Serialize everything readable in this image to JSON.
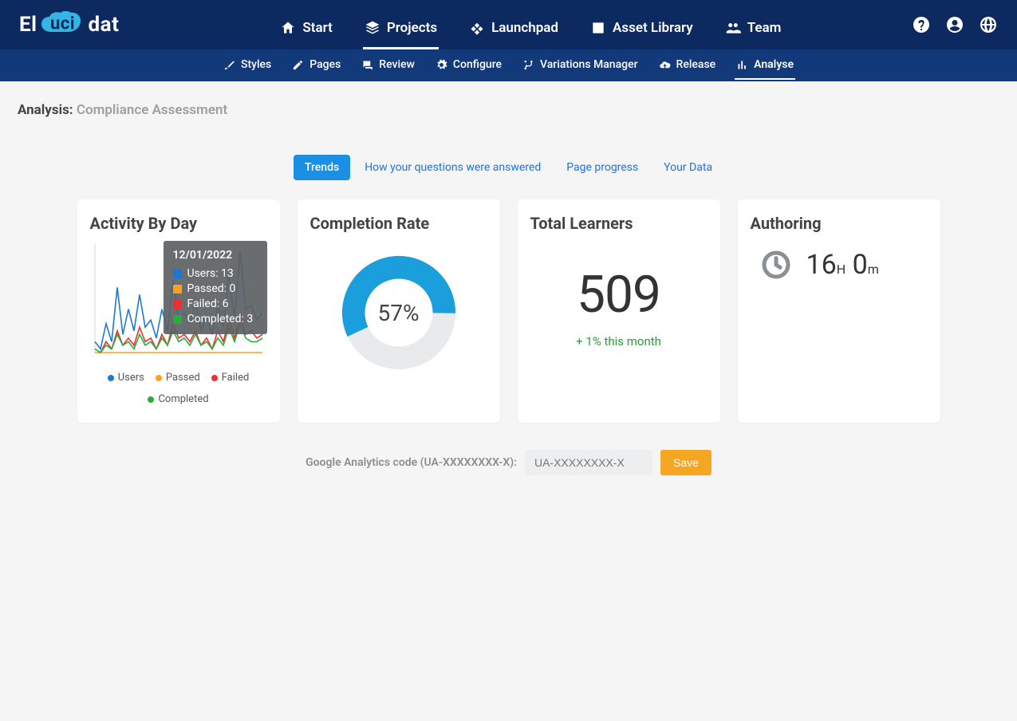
{
  "colors": {
    "blue": "#1f77d4",
    "orange": "#ff9f1a",
    "red": "#ef2f2f",
    "green": "#27ae3c",
    "grey": "#e3e6e8",
    "donut": "#1a9fdc"
  },
  "header": {
    "logo_prefix": "El",
    "logo_cloud": "uci",
    "logo_suffix": "dat",
    "nav": [
      {
        "label": "Start",
        "icon": "home"
      },
      {
        "label": "Projects",
        "icon": "layers",
        "active": true
      },
      {
        "label": "Launchpad",
        "icon": "diamond"
      },
      {
        "label": "Asset Library",
        "icon": "image"
      },
      {
        "label": "Team",
        "icon": "people"
      }
    ]
  },
  "subnav": [
    {
      "label": "Styles",
      "icon": "brush"
    },
    {
      "label": "Pages",
      "icon": "pencil"
    },
    {
      "label": "Review",
      "icon": "chat"
    },
    {
      "label": "Configure",
      "icon": "gear"
    },
    {
      "label": "Variations Manager",
      "icon": "branch"
    },
    {
      "label": "Release",
      "icon": "cloud-up"
    },
    {
      "label": "Analyse",
      "icon": "bar-chart",
      "active": true
    }
  ],
  "page": {
    "title_prefix": "Analysis:",
    "title_project": "Compliance Assessment"
  },
  "tabs": [
    {
      "label": "Trends",
      "active": true
    },
    {
      "label": "How your questions were answered"
    },
    {
      "label": "Page progress"
    },
    {
      "label": "Your Data"
    }
  ],
  "cards": {
    "activity": {
      "title": "Activity By Day",
      "tooltip": {
        "date": "12/01/2022",
        "rows": [
          {
            "label": "Users: 13",
            "color": "#1f77d4"
          },
          {
            "label": "Passed: 0",
            "color": "#ff9f1a"
          },
          {
            "label": "Failed: 6",
            "color": "#ef2f2f"
          },
          {
            "label": "Completed: 3",
            "color": "#27ae3c"
          }
        ]
      },
      "legend": [
        {
          "label": "Users",
          "color": "#1f77d4"
        },
        {
          "label": "Passed",
          "color": "#ff9f1a"
        },
        {
          "label": "Failed",
          "color": "#ef2f2f"
        },
        {
          "label": "Completed",
          "color": "#27ae3c"
        }
      ]
    },
    "completion": {
      "title": "Completion Rate",
      "percent_label": "57%",
      "percent_value": 57
    },
    "learners": {
      "title": "Total Learners",
      "value": "509",
      "delta": "+ 1% this month"
    },
    "authoring": {
      "title": "Authoring",
      "hours": "16",
      "hours_suffix": "H",
      "minutes": "0",
      "minutes_suffix": "m"
    }
  },
  "ga": {
    "label": "Google Analytics code (UA-XXXXXXXX-X):",
    "placeholder": "UA-XXXXXXXX-X",
    "save": "Save"
  },
  "chart_data": {
    "type": "line",
    "title": "Activity By Day",
    "xlabel": "",
    "ylabel": "",
    "ylim": [
      0,
      30
    ],
    "x_days": 31,
    "series": [
      {
        "name": "Users",
        "color": "#1f77d4",
        "values": [
          3,
          1,
          8,
          3,
          18,
          5,
          12,
          6,
          16,
          7,
          9,
          4,
          12,
          6,
          20,
          9,
          11,
          8,
          14,
          6,
          10,
          5,
          13,
          7,
          22,
          9,
          28,
          12,
          13,
          9,
          11
        ]
      },
      {
        "name": "Passed",
        "color": "#ff9f1a",
        "values": [
          0,
          0,
          0,
          0,
          0,
          0,
          0,
          0,
          0,
          0,
          0,
          0,
          0,
          0,
          0,
          0,
          0,
          0,
          0,
          0,
          0,
          0,
          0,
          0,
          0,
          0,
          0,
          0,
          0,
          0,
          0
        ]
      },
      {
        "name": "Failed",
        "color": "#ef2f2f",
        "values": [
          1,
          0,
          3,
          1,
          6,
          2,
          4,
          2,
          7,
          3,
          4,
          1,
          5,
          2,
          8,
          4,
          5,
          3,
          6,
          2,
          4,
          1,
          6,
          3,
          9,
          4,
          10,
          5,
          6,
          4,
          5
        ]
      },
      {
        "name": "Completed",
        "color": "#27ae3c",
        "values": [
          1,
          0,
          2,
          1,
          5,
          2,
          3,
          1,
          5,
          2,
          3,
          1,
          4,
          2,
          6,
          3,
          4,
          2,
          5,
          2,
          3,
          1,
          4,
          2,
          7,
          3,
          8,
          4,
          3,
          3,
          4
        ]
      }
    ],
    "tooltip_point": {
      "date": "12/01/2022",
      "Users": 13,
      "Passed": 0,
      "Failed": 6,
      "Completed": 3
    }
  }
}
